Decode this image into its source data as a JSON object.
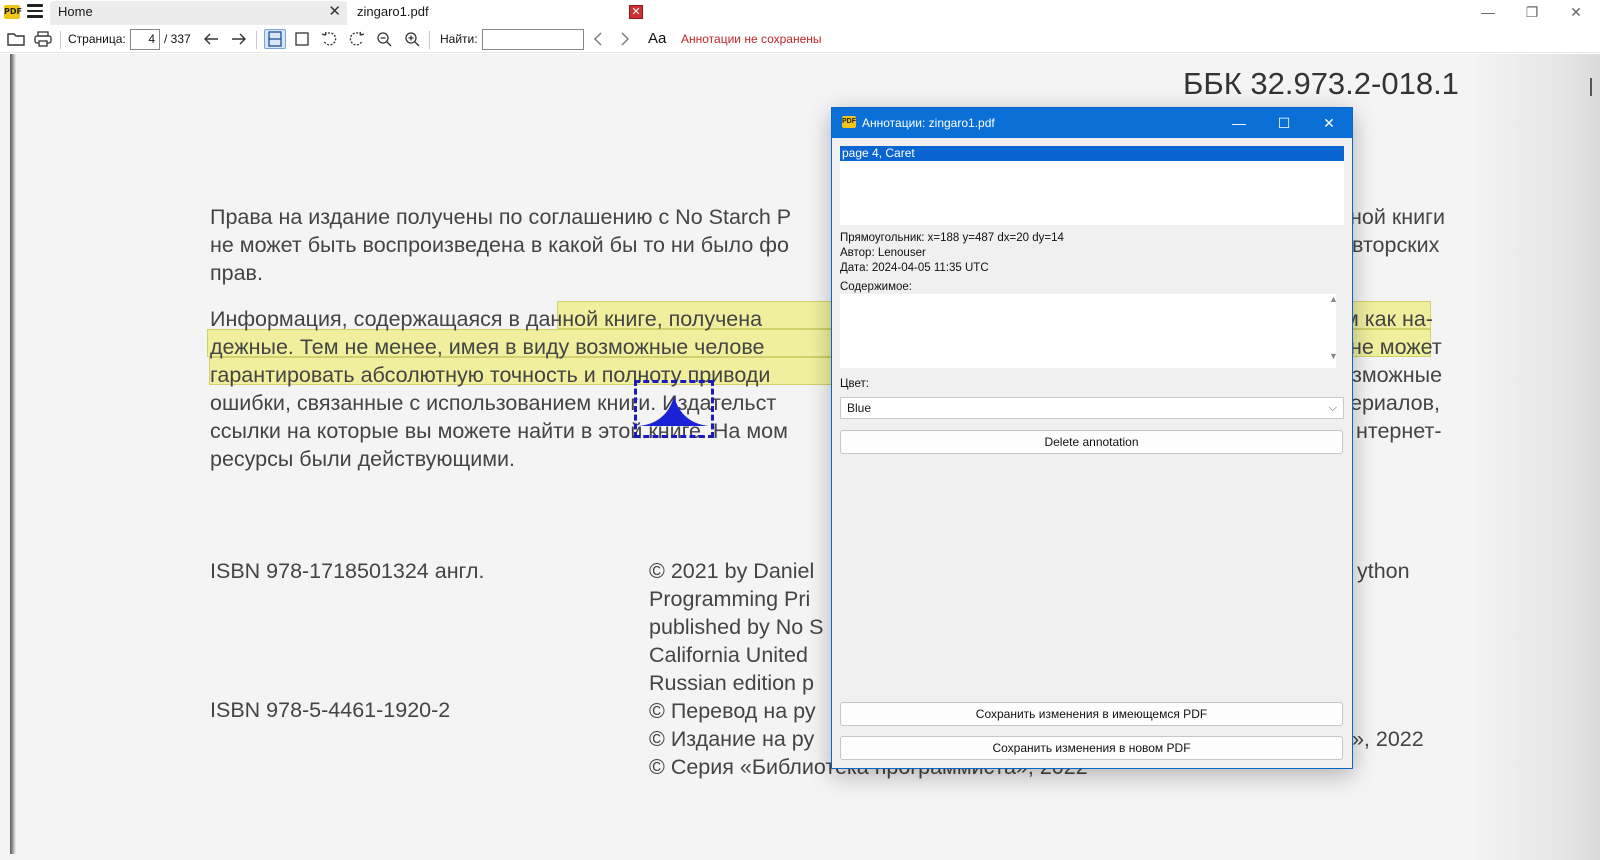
{
  "app": {
    "tabs": [
      {
        "label": "Home"
      },
      {
        "label": "zingaro1.pdf"
      }
    ],
    "window_controls": {
      "minimize": "—",
      "restore": "❐",
      "close": "✕"
    }
  },
  "toolbar": {
    "page_label": "Страница:",
    "page_current": "4",
    "page_total": "/ 337",
    "find_label": "Найти:",
    "find_value": "",
    "annotation_status": "Аннотации не сохранены",
    "font_glyph": "Aa"
  },
  "document": {
    "bbk": "ББК 32.973.2-018.1",
    "para1": [
      "Права на издание получены по соглашению с No Starch P",
      "не может быть воспроизведена в какой бы то ни было фо",
      "прав."
    ],
    "para1_right": [
      "ной книги",
      "вторских"
    ],
    "para2": [
      "Информация, содержащаяся в данной книге, получена",
      "дежные. Тем не менее, имея в виду возможные челове",
      "гарантировать абсолютную точность и полноту приводи",
      "ошибки, связанные с использованием книги. Издательст",
      "ссылки на которые вы можете найти в этой книге. На мом",
      "ресурсы были действующими."
    ],
    "para2_right": [
      "м как на-",
      "не может",
      "зможные",
      "ериалов,",
      "нтернет-"
    ],
    "isbn1": "ISBN 978-1718501324 англ.",
    "isbn2": "ISBN 978-5-4461-1920-2",
    "copyright_lines": [
      "© 2021 by Daniel",
      "Programming Pri",
      "published by No S",
      "California United",
      "Russian edition p",
      "© Перевод на ру",
      "© Издание на ру",
      "© Серия «Библиотека программиста», 2022"
    ],
    "copyright_right": [
      "ython",
      "а», 2022"
    ]
  },
  "dialog": {
    "title": "Аннотации: zingaro1.pdf",
    "annotations": [
      {
        "label": "page 4, Caret",
        "selected": true
      }
    ],
    "rect_info": "Прямоугольник: x=188 y=487 dx=20 dy=14",
    "author": "Автор: Lenouser",
    "date": "Дата: 2024-04-05 11:35 UTC",
    "content_label": "Содержимое:",
    "content_value": "",
    "color_label": "Цвет:",
    "color_value": "Blue",
    "delete_button": "Delete annotation",
    "save_existing_button": "Сохранить изменения в имеющемся PDF",
    "save_new_button": "Сохранить изменения в новом PDF"
  },
  "colors": {
    "accent": "#0a6fd6",
    "highlight": "#eeee82",
    "caret": "#1b1bbd",
    "status_red": "#c0262b"
  }
}
